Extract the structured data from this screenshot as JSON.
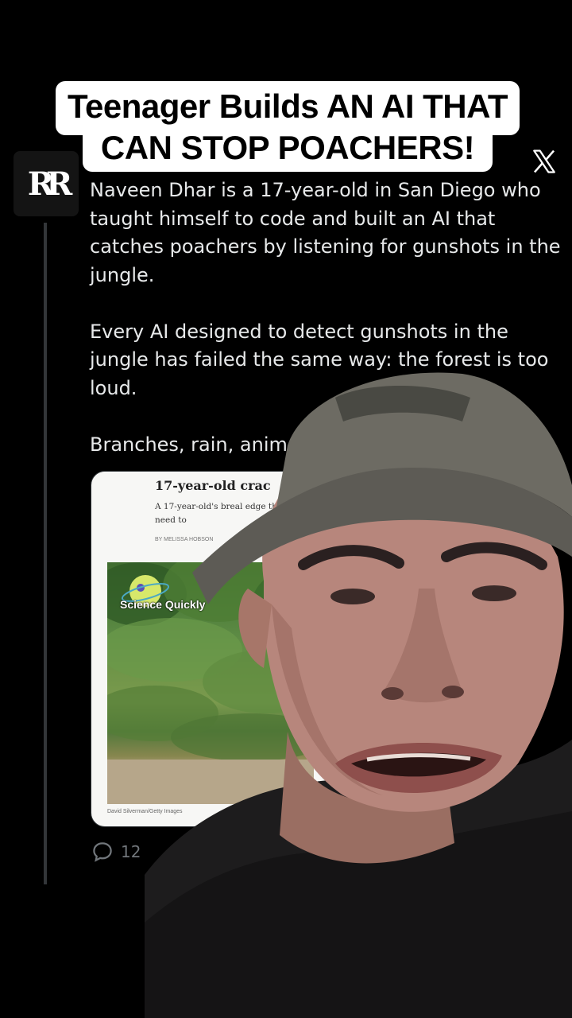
{
  "overlay": {
    "title": "Teenager Builds AN AI THAT CAN STOP POACHERS!"
  },
  "post": {
    "avatar_text": "RR",
    "platform_icon": "x-logo-icon",
    "paragraphs": [
      "Naveen Dhar is a 17-year-old in San Diego who taught himself to code and built an AI that catches poachers by listening for gunshots in the jungle.",
      "Every AI designed to detect gunshots in the jungle has failed the same way: the forest is too loud.",
      "Branches, rain, anim"
    ],
    "link_card": {
      "headline": "17-year-old crac",
      "subhead": "A 17-year-old's breal edge they need to",
      "byline": "BY MELISSA HOBSON",
      "badge": "Science Quickly",
      "credit": "David Silverman/Getty Images"
    },
    "actions": {
      "reply_icon": "reply-icon",
      "reply_count": "12",
      "retweet_icon": "retweet-icon"
    }
  },
  "colors": {
    "background": "#000000",
    "text": "#e7e9ea",
    "muted": "#71767b",
    "title_bg": "#ffffff"
  }
}
